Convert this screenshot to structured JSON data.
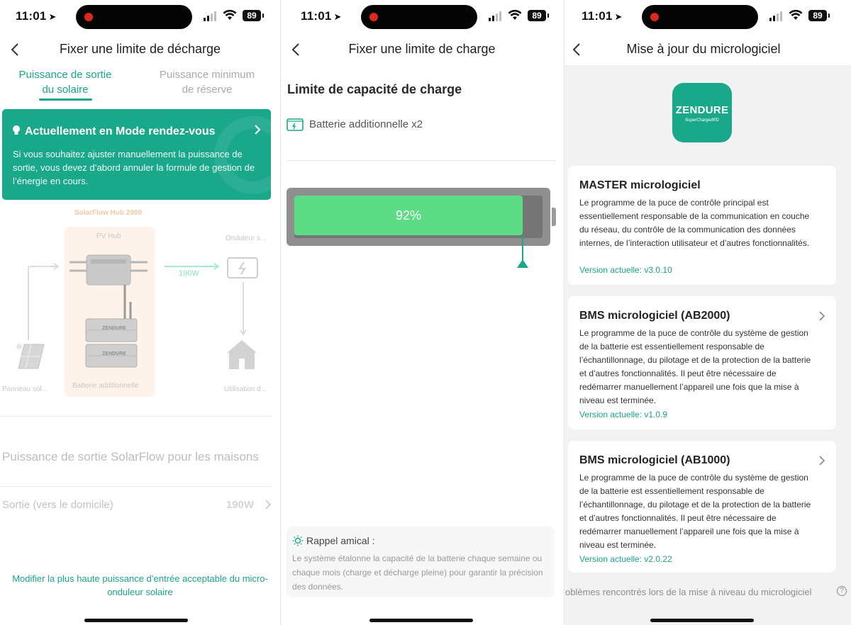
{
  "status": {
    "time": "11:01",
    "battery": "89"
  },
  "panel1": {
    "title": "Fixer une limite de décharge",
    "tabs": [
      {
        "label_line1": "Puissance de sortie",
        "label_line2": "du solaire",
        "active": true
      },
      {
        "label_line1": "Puissance minimum",
        "label_line2": "de réserve",
        "active": false
      }
    ],
    "mode_card": {
      "heading": "Actuellement en Mode rendez-vous",
      "body": "Si vous souhaitez ajuster manuellement la puissance de sortie, vous devez d’abord annuler la formule de gestion de l’énergie en cours."
    },
    "diagram": {
      "hub_title": "SolarFlow Hub 2000",
      "pv_hub": "PV Hub",
      "inverter": "Onduleur s...",
      "flow_value": "190W",
      "battery": "Batterie additionnelle",
      "solar_panel": "Panneau sol...",
      "home_usage": "Utilisation d...",
      "brand": "ZENDURE"
    },
    "section_title": "Puissance de sortie SolarFlow pour les maisons",
    "output_row": {
      "label": "Sortie (vers le domicile)",
      "value": "190W"
    },
    "bottom_link": "Modifier la plus haute puissance d’entrée acceptable du micro-onduleur solaire"
  },
  "panel2": {
    "title": "Fixer une limite de charge",
    "heading": "Limite de capacité de charge",
    "battery_label": "Batterie additionnelle x2",
    "charge_percent_label": "92%",
    "charge_fraction": 0.92,
    "reminder": {
      "title": "Rappel amical :",
      "body": "Le système étalonne la capacité de la batterie chaque semaine ou chaque mois (charge et décharge pleine) pour garantir la précision des données."
    }
  },
  "panel3": {
    "title": "Mise à jour du micrologiciel",
    "logo": {
      "brand": "ZENDURE",
      "tag": "SuperCharged®D"
    },
    "cards": [
      {
        "title": "MASTER micrologiciel",
        "desc": "Le programme de la puce de contrôle principal est essentiellement responsable de la communication en couche du réseau, du contrôle de la communication des données internes, de l’interaction utilisateur et d’autres fonctionnalités.",
        "version": "Version actuelle: v3.0.10"
      },
      {
        "title": "BMS micrologiciel (AB2000)",
        "desc": "Le programme de la puce de contrôle du système de gestion de la batterie est essentiellement responsable de l’échantillonnage, du pilotage et de la protection de la batterie et d’autres fonctionnalités. Il peut être nécessaire de redémarrer manuellement l’appareil une fois que la mise à niveau est terminée.",
        "version": "Version actuelle: v1.0.9"
      },
      {
        "title": "BMS micrologiciel (AB1000)",
        "desc": "Le programme de la puce de contrôle du système de gestion de la batterie est essentiellement responsable de l’échantillonnage, du pilotage et de la protection de la batterie et d’autres fonctionnalités. Il peut être nécessaire de redémarrer manuellement l’appareil une fois que la mise à niveau est terminée.",
        "version": "Version actuelle: v2.0.22"
      }
    ],
    "footer": "oblèmes rencontrés lors de la mise à niveau du micrologiciel",
    "footer_icon": "?"
  },
  "colors": {
    "accent": "#19a58a",
    "battery_fill": "#5bdc85"
  }
}
